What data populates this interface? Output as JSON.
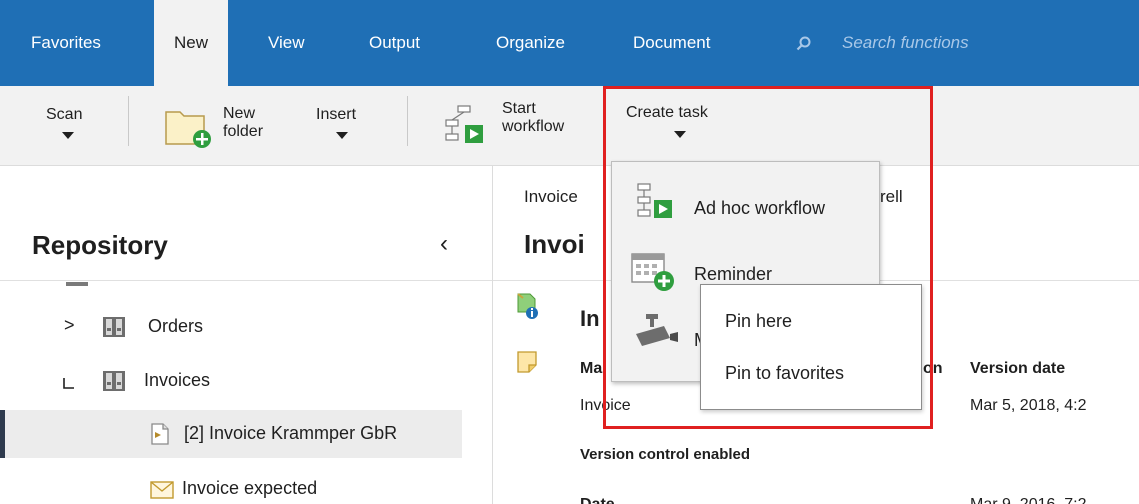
{
  "menubar": {
    "tabs": [
      {
        "label": "Favorites",
        "active": false
      },
      {
        "label": "New",
        "active": true
      },
      {
        "label": "View",
        "active": false
      },
      {
        "label": "Output",
        "active": false
      },
      {
        "label": "Organize",
        "active": false
      },
      {
        "label": "Document",
        "active": false
      }
    ],
    "search_placeholder": "Search functions",
    "bg_color": "#1f6fb5"
  },
  "ribbon": {
    "scan": "Scan",
    "new_folder_line1": "New",
    "new_folder_line2": "folder",
    "insert": "Insert",
    "start_workflow_line1": "Start",
    "start_workflow_line2": "workflow",
    "create_task": "Create task"
  },
  "repository": {
    "title": "Repository",
    "collapse_icon": "chevron-left-icon",
    "items": [
      {
        "label": "Orders",
        "icon": "binder-icon"
      },
      {
        "label": "Invoices",
        "icon": "binder-icon"
      },
      {
        "label": "[2] Invoice Krammper GbR",
        "icon": "document-icon",
        "selected": true
      },
      {
        "label": "Invoice expected",
        "icon": "envelope-icon"
      }
    ]
  },
  "content": {
    "breadcrumb_start": "Invoice",
    "breadcrumb_end": "rell",
    "title_partial": "Invoi",
    "section_partial": "In",
    "col_partial": "Ma",
    "col_partial_right": "on",
    "version_date_label": "Version date",
    "row_type_prefix": "In",
    "row_type_suffix": "voice",
    "version_date_value": "Mar 5, 2018, 4:2",
    "version_control": "Version control enabled",
    "bottom_partial": "Date",
    "bottom_value": "Mar 9, 2016, 7:2"
  },
  "create_task_menu": {
    "items": [
      {
        "label": "Ad hoc workflow",
        "icon": "workflow-icon"
      },
      {
        "label": "Reminder",
        "icon": "reminder-calendar-icon"
      },
      {
        "label": "M",
        "icon": "camera-icon"
      }
    ]
  },
  "pin_menu": {
    "items": [
      "Pin here",
      "Pin to favorites"
    ]
  },
  "colors": {
    "accent": "#1f6fb5",
    "highlight": "#e02020",
    "green": "#2f9e3f"
  }
}
